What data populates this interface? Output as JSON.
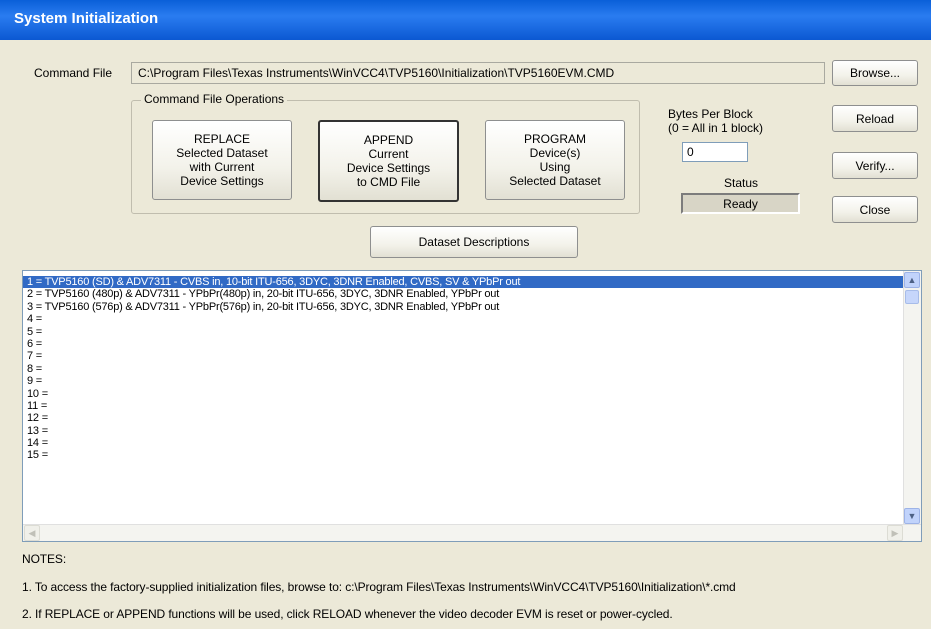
{
  "window": {
    "title": "System Initialization"
  },
  "command_file": {
    "label": "Command File",
    "path": "C:\\Program Files\\Texas Instruments\\WinVCC4\\TVP5160\\Initialization\\TVP5160EVM.CMD"
  },
  "buttons": {
    "browse": "Browse...",
    "reload": "Reload",
    "verify": "Verify...",
    "close": "Close"
  },
  "operations": {
    "group_label": "Command File Operations",
    "replace": "REPLACE\nSelected Dataset\nwith Current\nDevice Settings",
    "append": "APPEND\nCurrent\nDevice Settings\nto CMD File",
    "program": "PROGRAM\nDevice(s)\nUsing\nSelected Dataset"
  },
  "bytes_per_block": {
    "label": "Bytes Per Block\n(0 = All in 1 block)",
    "value": "0"
  },
  "status": {
    "label": "Status",
    "value": "Ready"
  },
  "dataset_descriptions_button": "Dataset Descriptions",
  "datasets": [
    "1 = TVP5160 (SD) & ADV7311 - CVBS in, 10-bit ITU-656, 3DYC, 3DNR Enabled, CVBS, SV & YPbPr out",
    "2 = TVP5160 (480p) & ADV7311 - YPbPr(480p) in, 20-bit ITU-656, 3DYC, 3DNR Enabled, YPbPr out",
    "3 = TVP5160 (576p) & ADV7311 - YPbPr(576p) in, 20-bit ITU-656, 3DYC, 3DNR Enabled, YPbPr out",
    "4 =",
    "5 =",
    "6 =",
    "7 =",
    "8 =",
    "9 =",
    "10 =",
    "11 =",
    "12 =",
    "13 =",
    "14 =",
    "15 ="
  ],
  "selected_dataset_index": 0,
  "notes": {
    "heading": "NOTES:",
    "note1": "1. To access the factory-supplied initialization files, browse to: c:\\Program Files\\Texas Instruments\\WinVCC4\\TVP5160\\Initialization\\*.cmd",
    "note2": "2. If REPLACE or APPEND functions will be used, click RELOAD whenever the video decoder EVM is reset or power-cycled."
  },
  "colors": {
    "titlebar": "#0b58d2",
    "selection": "#316ac5",
    "dialog_bg": "#ece9d8"
  }
}
